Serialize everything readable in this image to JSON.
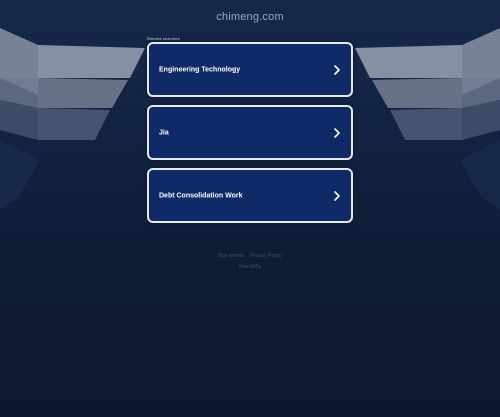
{
  "header": {
    "domain": "chimeng.com"
  },
  "related": {
    "label": "Related searches",
    "items": [
      {
        "label": "Engineering Technology"
      },
      {
        "label": "Jia"
      },
      {
        "label": "Debt Consolidation Work"
      }
    ]
  },
  "footer": {
    "links": [
      "Buy domain",
      "Privacy Policy"
    ],
    "id": "#bam5f6a"
  },
  "colors": {
    "background": "#101c34",
    "card": "#0f2a66",
    "card_border": "#e4e8f0",
    "wing": "#7a8398"
  },
  "icons": {
    "link_arrow": "chevron-right-icon"
  }
}
